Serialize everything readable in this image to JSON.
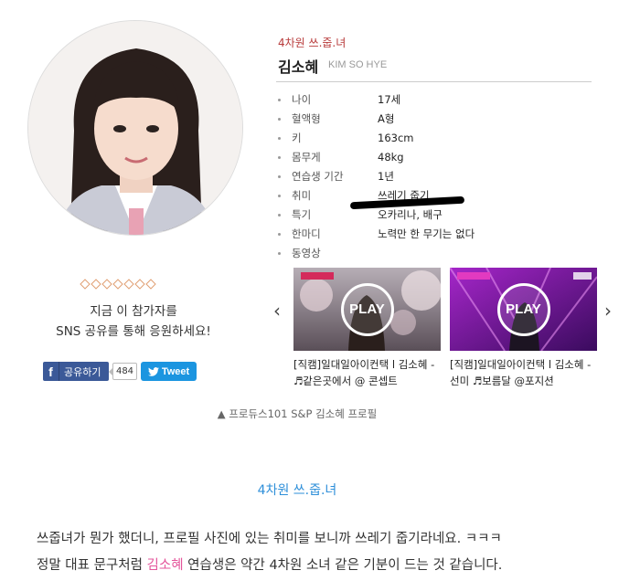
{
  "profile": {
    "subtitle": "4차원 쓰.줍.녀",
    "name": "김소혜",
    "name_en": "KIM SO HYE",
    "rows": [
      {
        "label": "나이",
        "value": "17세"
      },
      {
        "label": "혈액형",
        "value": "A형"
      },
      {
        "label": "키",
        "value": "163cm"
      },
      {
        "label": "몸무게",
        "value": "48kg"
      },
      {
        "label": "연습생 기간",
        "value": "1년"
      },
      {
        "label": "취미",
        "value": "쓰레기 줍기"
      },
      {
        "label": "특기",
        "value": "오카리나, 배구"
      },
      {
        "label": "한마디",
        "value": "노력만 한 무기는 없다"
      },
      {
        "label": "동영상",
        "value": ""
      }
    ]
  },
  "share": {
    "line1": "지금 이 참가자를",
    "line2": "SNS 공유를 통해 응원하세요!",
    "fb_label": "공유하기",
    "fb_count": "484",
    "tw_label": "Tweet"
  },
  "videos": [
    {
      "play": "PLAY",
      "title": "[직캠]일대일아이컨택 l 김소혜 - ♬같은곳에서 @ 콘셉트"
    },
    {
      "play": "PLAY",
      "title": "[직캠]일대일아이컨택 l 김소혜 - 선미 ♬보름달 @포지션"
    }
  ],
  "caption": "▲ 프로듀스101 S&P 김소혜 프로필",
  "article": {
    "heading": "4차원 쓰.줍.녀",
    "line1": "쓰줍녀가 뭔가 했더니, 프로필 사진에 있는 취미를 보니까 쓰레기 줍기라네요. ㅋㅋㅋ",
    "line2_before": "정말 대표 문구처럼 ",
    "line2_name": "김소혜",
    "line2_after": " 연습생은 약간 4차원 소녀 같은 기분이 드는 것 같습니다."
  },
  "colors": {
    "accent_red": "#b83b3b",
    "heading_blue": "#2e8fd9",
    "name_pink": "#e4559b",
    "facebook": "#3b5998",
    "twitter": "#1b95e0"
  }
}
